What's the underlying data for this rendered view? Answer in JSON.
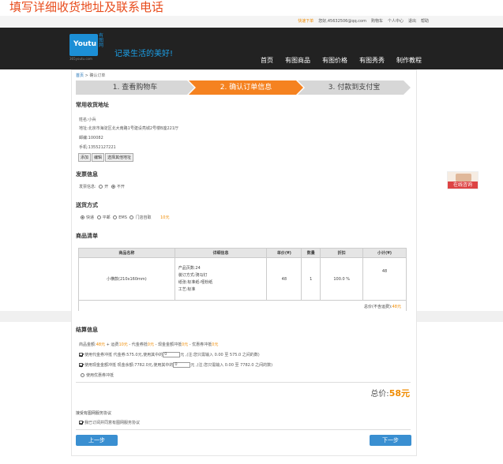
{
  "annotation_title": "填写详细收货地址及联系电话",
  "topbar": {
    "fast_login": "快速下单",
    "greeting": "您好,45632506@qq.com",
    "cart": "购物车",
    "personal": "个人中心",
    "logout": "退出",
    "help": "帮助"
  },
  "header": {
    "logo_text": "Youtu",
    "logo_cn": "有图网",
    "logo_domain": "365youtu.com",
    "slogan": "记录生活的美好!",
    "nav": [
      "首页",
      "有图商品",
      "有图价格",
      "有图秀秀",
      "制作教程"
    ]
  },
  "breadcrumb": {
    "home": "首页",
    "sep": " > ",
    "current": "确认订单"
  },
  "steps": [
    "1. 查看购物车",
    "2. 确认订单信息",
    "3. 付款到支付宝"
  ],
  "address": {
    "title": "常用收货地址",
    "name": "姓名:小兵",
    "address": "地址:北京市海淀区北大南路1号建设亮城2号楼B座221厅",
    "postcode": "邮编:100082",
    "phone": "手机:13552127221",
    "buttons": [
      "添加",
      "编辑",
      "选择其他地址"
    ]
  },
  "invoice": {
    "title": "发票信息",
    "label": "发票信息:",
    "options": [
      "开",
      "不开"
    ]
  },
  "shipping": {
    "title": "送货方式",
    "options": [
      "快递",
      "平邮",
      "EMS",
      "门店自取"
    ],
    "fee": "10元"
  },
  "goods": {
    "title": "商品清单",
    "headers": [
      "商品名称",
      "详细信息",
      "单价(¥)",
      "数量",
      "折扣",
      "小计(¥)"
    ],
    "rows": [
      {
        "name": "小横款(210x160mm)",
        "details": [
          "产品页数:24",
          "装订方式:骑马钉",
          "纸张:标准纸-哑粉纸",
          "工艺:标准"
        ],
        "price": "48",
        "qty": "1",
        "discount": "100.0 %",
        "subtotal": "48"
      }
    ],
    "total_label": "总价(不含运费):",
    "total_value": "48元"
  },
  "settlement": {
    "title": "结算信息",
    "summary": [
      "商品金额:",
      "48元",
      " + 运费",
      "10元",
      " - 代金券抵",
      "0元",
      " - 现金金额冲抵",
      "0元",
      " - 优惠券冲抵",
      "0元"
    ],
    "voucher_label": "使用代金券冲抵  代金券:575.0元,使用其中的",
    "voucher_value": "0",
    "voucher_hint": "元 ,(注:您只需输入 0.00 至 575.0 之间的数)",
    "cash_label": "使用现金金额冲抵 现金余额:7782.0元,使用其中的",
    "cash_value": "0",
    "cash_hint": "元 ,(注:您只需输入 0.00 至 7782.0 之间的数)",
    "coupon_label": "使用优惠券冲抵",
    "total_label": "总价:",
    "total_value": "58元"
  },
  "agreement": {
    "title": "接受有图网服务协议",
    "text": "我已订阅并同意有图网服务协议"
  },
  "buttons": {
    "prev": "上一步",
    "next": "下一步"
  },
  "side_float": {
    "label": "在线咨询"
  }
}
